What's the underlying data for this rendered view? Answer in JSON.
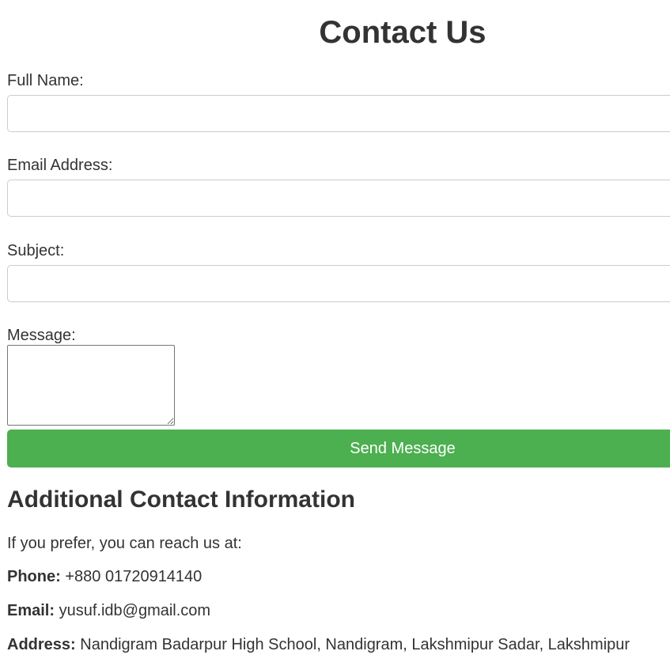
{
  "page": {
    "title": "Contact Us"
  },
  "form": {
    "full_name_label": "Full Name:",
    "full_name_value": "",
    "email_label": "Email Address:",
    "email_value": "",
    "subject_label": "Subject:",
    "subject_value": "",
    "message_label": "Message:",
    "message_value": "",
    "submit_label": "Send Message"
  },
  "additional": {
    "heading": "Additional Contact Information",
    "intro": "If you prefer, you can reach us at:",
    "phone_label": "Phone:",
    "phone_value": "+880 01720914140",
    "email_label": "Email:",
    "email_value": "yusuf.idb@gmail.com",
    "address_label": "Address:",
    "address_value": "Nandigram Badarpur High School, Nandigram, Lakshmipur Sadar, Lakshmipur"
  },
  "colors": {
    "button_background": "#4caf50",
    "button_text": "#ffffff",
    "text": "#333333",
    "input_border": "#cccccc"
  }
}
